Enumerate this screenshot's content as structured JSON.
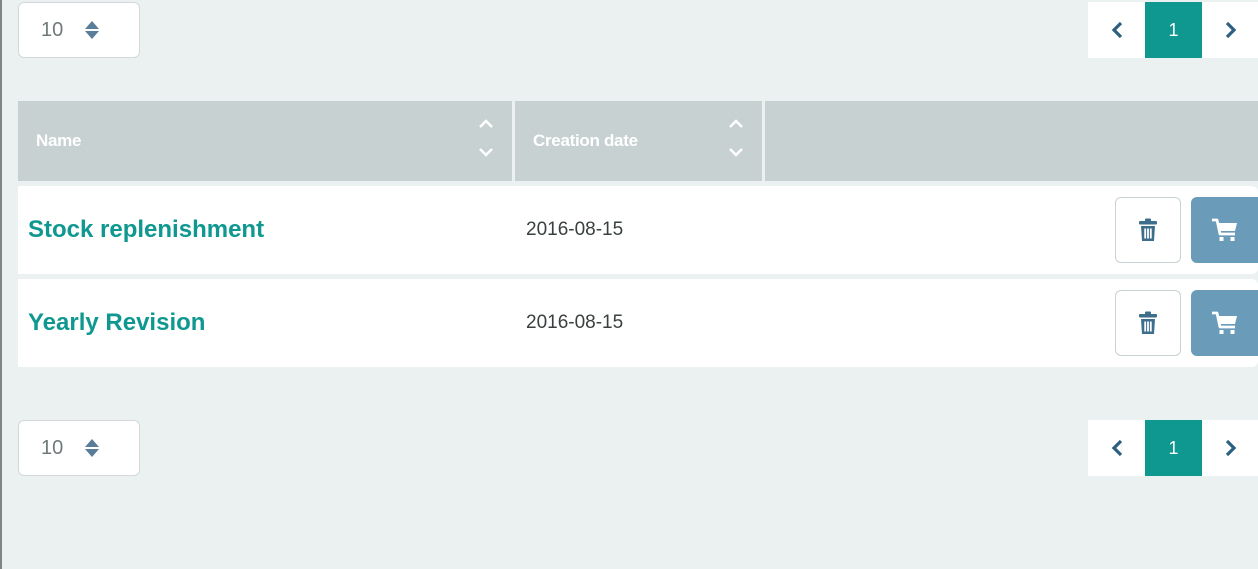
{
  "top_controls": {
    "per_page": "10",
    "pagination": {
      "prev_icon": "chevron-left-icon",
      "current_page": "1",
      "next_icon": "chevron-right-icon"
    }
  },
  "table": {
    "columns": [
      {
        "label": "Name",
        "sortable": true
      },
      {
        "label": "Creation date",
        "sortable": true
      },
      {
        "label": "",
        "sortable": false
      }
    ],
    "rows": [
      {
        "name": "Stock replenishment",
        "creation_date": "2016-08-15",
        "actions": [
          "trash-icon",
          "cart-icon"
        ]
      },
      {
        "name": "Yearly Revision",
        "creation_date": "2016-08-15",
        "actions": [
          "trash-icon",
          "cart-icon"
        ]
      }
    ]
  },
  "bottom_controls": {
    "per_page": "10",
    "pagination": {
      "prev_icon": "chevron-left-icon",
      "current_page": "1",
      "next_icon": "chevron-right-icon"
    }
  },
  "colors": {
    "background": "#ebf0f0",
    "accent": "#0f9890",
    "header": "#c7d1d2",
    "cart_button": "#6a9bb8",
    "icon_blue": "#3e6e8e"
  }
}
